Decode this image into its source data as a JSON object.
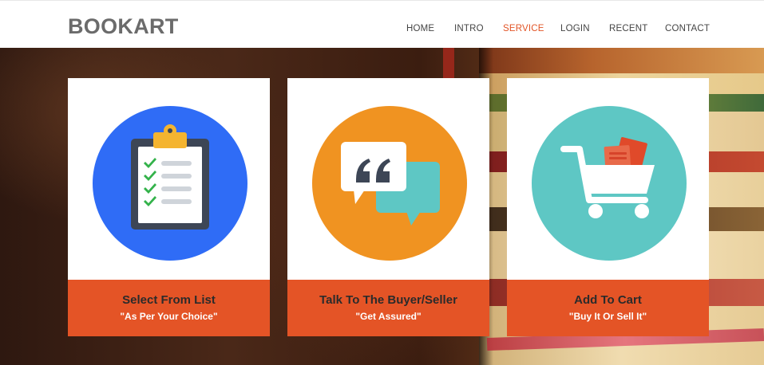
{
  "brand": "BOOKART",
  "nav": [
    {
      "label": "HOME",
      "active": false
    },
    {
      "label": "INTRO",
      "active": false
    },
    {
      "label": "SERVICE",
      "active": true
    },
    {
      "label": "LOGIN",
      "active": false
    },
    {
      "label": "RECENT",
      "active": false
    },
    {
      "label": "CONTACT",
      "active": false
    }
  ],
  "colors": {
    "accent": "#e25426",
    "caption_bg": "#e45426",
    "circle_blue": "#2f6cf6",
    "circle_orange": "#f09321",
    "circle_teal": "#5ec7c4"
  },
  "cards": [
    {
      "icon": "clipboard-checklist-icon",
      "title": "Select From List",
      "subtitle": "\"As Per Your Choice\""
    },
    {
      "icon": "chat-bubbles-quote-icon",
      "title": "Talk To The Buyer/Seller",
      "subtitle": "\"Get Assured\""
    },
    {
      "icon": "shopping-cart-books-icon",
      "title": "Add To Cart",
      "subtitle": "\"Buy It Or Sell It\""
    }
  ]
}
